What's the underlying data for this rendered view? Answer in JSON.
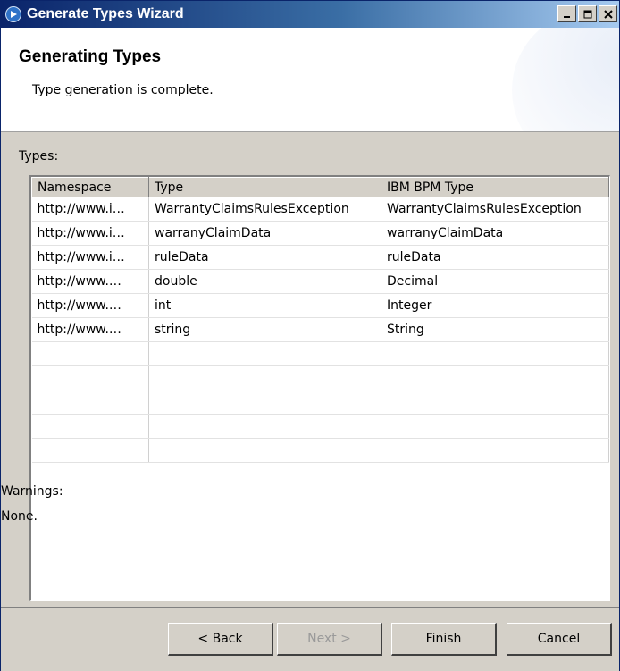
{
  "window": {
    "title": "Generate Types Wizard",
    "controls": {
      "minimize": "_",
      "maximize": "□",
      "close": "✕"
    }
  },
  "header": {
    "heading": "Generating Types",
    "description": "Type generation is complete."
  },
  "types_section": {
    "label": "Types:",
    "columns": [
      "Namespace",
      "Type",
      "IBM BPM Type"
    ],
    "rows": [
      [
        "http://www.i…",
        "WarrantyClaimsRulesException",
        "WarrantyClaimsRulesException"
      ],
      [
        "http://www.i…",
        "warranyClaimData",
        "warranyClaimData"
      ],
      [
        "http://www.i…",
        "ruleData",
        "ruleData"
      ],
      [
        "http://www.…",
        "double",
        "Decimal"
      ],
      [
        "http://www.…",
        "int",
        "Integer"
      ],
      [
        "http://www.…",
        "string",
        "String"
      ]
    ]
  },
  "warnings": {
    "label": "Warnings:",
    "value": "None."
  },
  "buttons": {
    "back": "< Back",
    "next": "Next >",
    "finish": "Finish",
    "cancel": "Cancel"
  },
  "colors": {
    "titlebar_start": "#0a246a",
    "titlebar_end": "#a6caf0",
    "dialog_bg": "#d4d0c8"
  }
}
